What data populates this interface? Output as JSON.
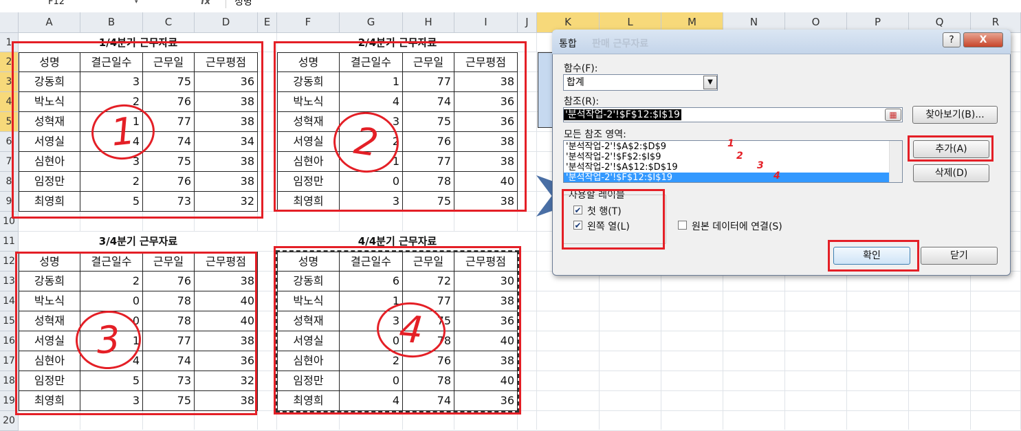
{
  "name_box": "F12",
  "formula_bar": "성명",
  "fx_icon": "fx",
  "columns": [
    "A",
    "B",
    "C",
    "D",
    "E",
    "F",
    "G",
    "H",
    "I",
    "J",
    "K",
    "L",
    "M",
    "N",
    "O",
    "P",
    "Q",
    "R"
  ],
  "rows": [
    "1",
    "2",
    "3",
    "4",
    "5",
    "6",
    "7",
    "8",
    "9",
    "10",
    "11",
    "12",
    "13",
    "14",
    "15",
    "16",
    "17",
    "18",
    "19",
    "20"
  ],
  "headers": [
    "성명",
    "결근일수",
    "근무일",
    "근무평점"
  ],
  "tables": [
    {
      "title": "1/4분기 근무자료",
      "rows": [
        [
          "강동희",
          "3",
          "75",
          "36"
        ],
        [
          "박노식",
          "2",
          "76",
          "38"
        ],
        [
          "성혁재",
          "1",
          "77",
          "38"
        ],
        [
          "서영실",
          "4",
          "74",
          "34"
        ],
        [
          "심현아",
          "3",
          "75",
          "38"
        ],
        [
          "임정만",
          "2",
          "76",
          "38"
        ],
        [
          "최영희",
          "5",
          "73",
          "32"
        ]
      ]
    },
    {
      "title": "2/4분기 근무자료",
      "rows": [
        [
          "강동희",
          "1",
          "77",
          "38"
        ],
        [
          "박노식",
          "4",
          "74",
          "36"
        ],
        [
          "성혁재",
          "3",
          "75",
          "36"
        ],
        [
          "서영실",
          "2",
          "76",
          "38"
        ],
        [
          "심현아",
          "1",
          "77",
          "38"
        ],
        [
          "임정만",
          "0",
          "78",
          "40"
        ],
        [
          "최영희",
          "3",
          "75",
          "38"
        ]
      ]
    },
    {
      "title": "3/4분기 근무자료",
      "rows": [
        [
          "강동희",
          "2",
          "76",
          "38"
        ],
        [
          "박노식",
          "0",
          "78",
          "40"
        ],
        [
          "성혁재",
          "0",
          "78",
          "40"
        ],
        [
          "서영실",
          "1",
          "77",
          "38"
        ],
        [
          "심현아",
          "4",
          "74",
          "36"
        ],
        [
          "임정만",
          "5",
          "73",
          "32"
        ],
        [
          "최영희",
          "3",
          "75",
          "38"
        ]
      ]
    },
    {
      "title": "4/4분기 근무자료",
      "rows": [
        [
          "강동희",
          "6",
          "72",
          "30"
        ],
        [
          "박노식",
          "1",
          "77",
          "38"
        ],
        [
          "성혁재",
          "3",
          "75",
          "36"
        ],
        [
          "서영실",
          "0",
          "78",
          "40"
        ],
        [
          "심현아",
          "2",
          "76",
          "38"
        ],
        [
          "임정만",
          "0",
          "78",
          "40"
        ],
        [
          "최영희",
          "4",
          "74",
          "36"
        ]
      ]
    }
  ],
  "annotations": [
    "1",
    "2",
    "3",
    "4"
  ],
  "dialog": {
    "title": "통합",
    "title_ghost": "판매 근무자료",
    "help": "?",
    "close": "X",
    "function_label": "함수(F):",
    "function_value": "합계",
    "reference_label": "참조(R):",
    "reference_value": "'분석작업-2'!$F$12:$I$19",
    "browse_button": "찾아보기(B)...",
    "all_refs_label": "모든 참조 영역:",
    "refs": [
      "'분석작업-2'!$A$2:$D$9",
      "'분석작업-2'!$F$2:$I$9",
      "'분석작업-2'!$A$12:$D$19",
      "'분석작업-2'!$F$12:$I$19"
    ],
    "add_button": "추가(A)",
    "delete_button": "삭제(D)",
    "labels_group": "사용할 레이블",
    "first_row": "첫 행(T)",
    "left_col": "왼쪽 열(L)",
    "link_source": "원본 데이터에 연결(S)",
    "ok_button": "확인",
    "close_button": "닫기",
    "handwritten_marks": [
      "1",
      "2",
      "3",
      "4"
    ]
  },
  "colors": {
    "highlight_red": "#e41f26",
    "selected_header": "#f7d97a",
    "selection_blue": "#3399ff"
  }
}
